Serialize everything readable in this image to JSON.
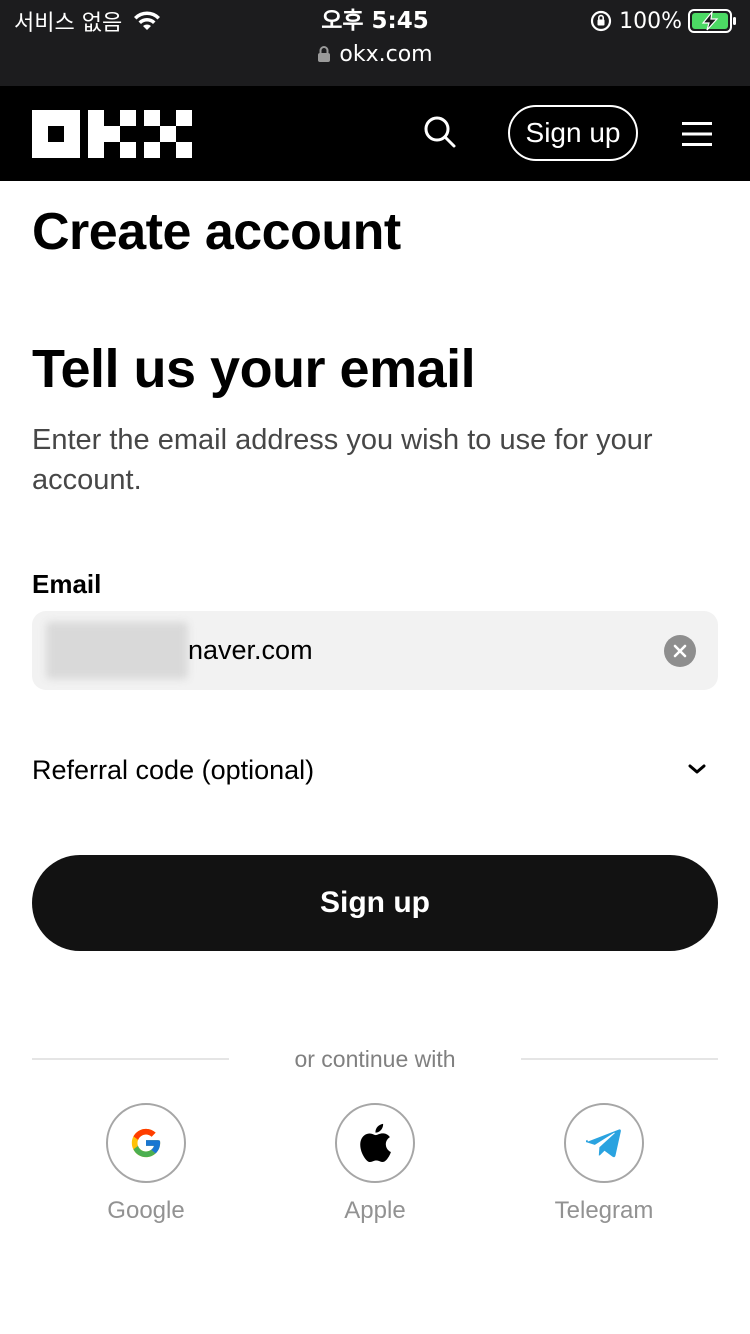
{
  "status_bar": {
    "carrier": "서비스 없음",
    "time": "오후 5:45",
    "battery": "100%",
    "url": "okx.com"
  },
  "header": {
    "signup_label": "Sign up"
  },
  "page": {
    "title": "Create account",
    "heading": "Tell us your email",
    "description": "Enter the email address you wish to use for your account."
  },
  "form": {
    "email_label": "Email",
    "email_value": "naver.com",
    "referral_label": "Referral code (optional)",
    "submit_label": "Sign up"
  },
  "social": {
    "divider_text": "or continue with",
    "options": [
      {
        "label": "Google",
        "icon": "google-icon"
      },
      {
        "label": "Apple",
        "icon": "apple-icon"
      },
      {
        "label": "Telegram",
        "icon": "telegram-icon"
      }
    ]
  },
  "colors": {
    "header_bg": "#000000",
    "status_bar_bg": "#1c1c1e",
    "button_bg": "#121212",
    "input_bg": "#f2f2f2",
    "telegram_blue": "#2aa3e0",
    "battery_green": "#4cd964"
  }
}
